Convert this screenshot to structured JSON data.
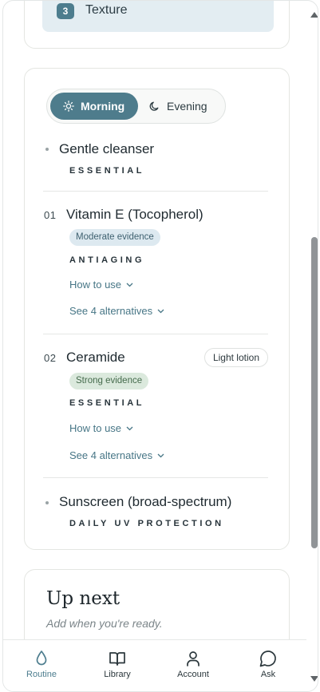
{
  "top_card": {
    "step_number": "3",
    "label": "Texture"
  },
  "toggle": {
    "morning": "Morning",
    "evening": "Evening",
    "active": "morning"
  },
  "items": [
    {
      "name": "Gentle cleanser",
      "tag": "ESSENTIAL"
    },
    {
      "number": "01",
      "name": "Vitamin E (Tocopherol)",
      "evidence": "Moderate evidence",
      "tag": "ANTIAGING",
      "how_to_use": "How to use",
      "alternatives": "See 4 alternatives"
    },
    {
      "number": "02",
      "name": "Ceramide",
      "texture": "Light lotion",
      "evidence": "Strong evidence",
      "tag": "ESSENTIAL",
      "how_to_use": "How to use",
      "alternatives": "See 4 alternatives"
    },
    {
      "name": "Sunscreen (broad-spectrum)",
      "tag": "DAILY UV PROTECTION"
    }
  ],
  "up_next": {
    "title": "Up next",
    "subtitle": "Add when you're ready."
  },
  "nav": [
    {
      "label": "Routine",
      "icon": "drop-icon",
      "active": true
    },
    {
      "label": "Library",
      "icon": "book-icon",
      "active": false
    },
    {
      "label": "Account",
      "icon": "person-icon",
      "active": false
    },
    {
      "label": "Ask",
      "icon": "chat-bubble-icon",
      "active": false
    }
  ],
  "colors": {
    "accent": "#4e7c8c",
    "link": "#477686",
    "moderate_badge_bg": "#dde9f0",
    "strong_badge_bg": "#dbe9dd"
  }
}
